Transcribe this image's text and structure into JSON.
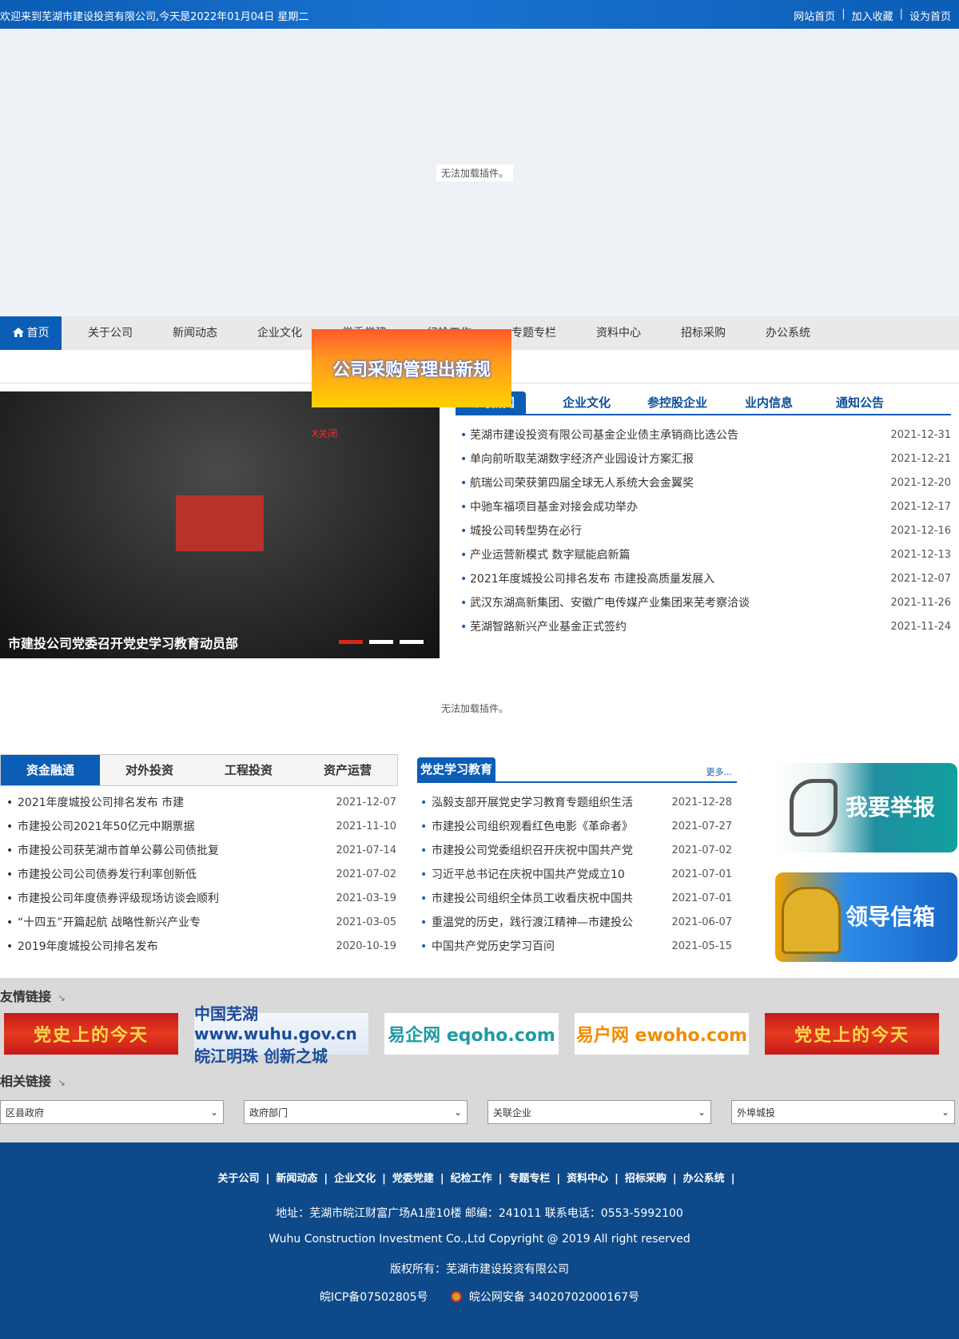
{
  "topbar": {
    "welcome": "欢迎来到芜湖市建设投资有限公司,今天是2022年01月04日 星期二",
    "links": [
      "网站首页",
      "加入收藏",
      "设为首页"
    ]
  },
  "banner": {
    "plugin_message": "无法加载插件。"
  },
  "nav": {
    "items": [
      "首页",
      "关于公司",
      "新闻动态",
      "企业文化",
      "党委党建",
      "纪检工作",
      "专题专栏",
      "资料中心",
      "招标采购",
      "办公系统"
    ]
  },
  "float_ad": {
    "text": "公司采购管理出新规",
    "close": "X关闭"
  },
  "slider": {
    "caption": "市建投公司党委召开党史学习教育动员部",
    "dots": 3
  },
  "news": {
    "tabs": [
      "公司新闻",
      "企业文化",
      "参控股企业",
      "业内信息",
      "通知公告"
    ],
    "items": [
      {
        "title": "芜湖市建设投资有限公司基金企业债主承销商比选公告",
        "date": "2021-12-31"
      },
      {
        "title": "单向前听取芜湖数字经济产业园设计方案汇报",
        "date": "2021-12-21"
      },
      {
        "title": "航瑞公司荣获第四届全球无人系统大会金翼奖",
        "date": "2021-12-20"
      },
      {
        "title": "中驰车福项目基金对接会成功举办",
        "date": "2021-12-17"
      },
      {
        "title": "城投公司转型势在必行",
        "date": "2021-12-16"
      },
      {
        "title": "产业运营新模式 数字赋能启新篇",
        "date": "2021-12-13"
      },
      {
        "title": "2021年度城投公司排名发布 市建投高质量发展入",
        "date": "2021-12-07"
      },
      {
        "title": "武汉东湖高新集团、安徽广电传媒产业集团来芜考察洽谈",
        "date": "2021-11-26"
      },
      {
        "title": "芜湖智路新兴产业基金正式签约",
        "date": "2021-11-24"
      }
    ]
  },
  "middle_plugin": {
    "message": "无法加载插件。"
  },
  "finance": {
    "tabs": [
      "资金融通",
      "对外投资",
      "工程投资",
      "资产运营"
    ],
    "items": [
      {
        "title": "2021年度城投公司排名发布 市建",
        "date": "2021-12-07"
      },
      {
        "title": "市建投公司2021年50亿元中期票据",
        "date": "2021-11-10"
      },
      {
        "title": "市建投公司获芜湖市首单公募公司债批复",
        "date": "2021-07-14"
      },
      {
        "title": "市建投公司公司债券发行利率创新低",
        "date": "2021-07-02"
      },
      {
        "title": "市建投公司年度债券评级现场访谈会顺利",
        "date": "2021-03-19"
      },
      {
        "title": "“十四五”开篇起航 战略性新兴产业专",
        "date": "2021-03-05"
      },
      {
        "title": "2019年度城投公司排名发布",
        "date": "2020-10-19"
      }
    ]
  },
  "party": {
    "title": "党史学习教育",
    "more": "更多...",
    "items": [
      {
        "title": "泓毅支部开展党史学习教育专题组织生活",
        "date": "2021-12-28"
      },
      {
        "title": "市建投公司组织观看红色电影《革命者》",
        "date": "2021-07-27"
      },
      {
        "title": "市建投公司党委组织召开庆祝中国共产党",
        "date": "2021-07-02"
      },
      {
        "title": "习近平总书记在庆祝中国共产党成立10",
        "date": "2021-07-01"
      },
      {
        "title": "市建投公司组织全体员工收看庆祝中国共",
        "date": "2021-07-01"
      },
      {
        "title": "重温党的历史，践行渡江精神—市建投公",
        "date": "2021-06-07"
      },
      {
        "title": "中国共产党历史学习百问",
        "date": "2021-05-15"
      }
    ]
  },
  "side": {
    "report": "我要举报",
    "mailbox": "领导信箱"
  },
  "friend_links": {
    "title": "友情链接",
    "logos": [
      "党史上的今天",
      "中国芜湖 www.wuhu.gov.cn 皖江明珠 创新之城",
      "易企网 eqoho.com",
      "易户网 ewoho.com",
      "党史上的今天"
    ]
  },
  "related_links": {
    "title": "相关链接",
    "selects": [
      "区县政府",
      "政府部门",
      "关联企业",
      "外埠城投"
    ]
  },
  "footer": {
    "nav": [
      "关于公司",
      "新闻动态",
      "企业文化",
      "党委党建",
      "纪检工作",
      "专题专栏",
      "资料中心",
      "招标采购",
      "办公系统"
    ],
    "address": "地址：芜湖市皖江财富广场A1座10楼    邮编：241011    联系电话：0553-5992100",
    "copyright": "Wuhu Construction Investment Co.,Ltd Copyright @ 2019 All right reserved",
    "owner": "版权所有：芜湖市建设投资有限公司",
    "icp": "皖ICP备07502805号",
    "police": "皖公网安备 34020702000167号"
  },
  "colors": {
    "primary": "#0b5db5",
    "footer": "#0e4a8a",
    "accent_red": "#d9261c"
  }
}
